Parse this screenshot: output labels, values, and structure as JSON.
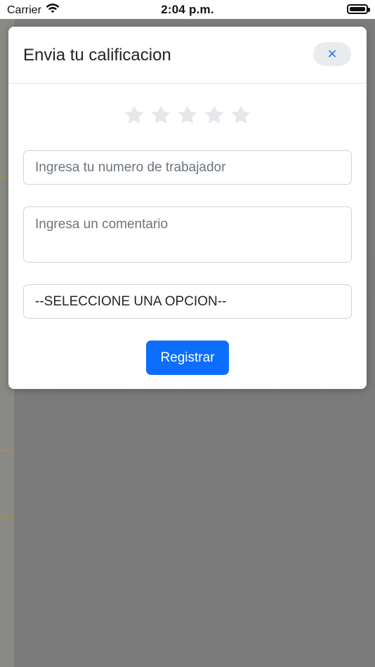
{
  "status_bar": {
    "carrier": "Carrier",
    "time": "2:04 p.m."
  },
  "modal": {
    "title": "Envia tu calificacion",
    "close_icon": "×",
    "rating": {
      "max": 5,
      "selected": 0
    },
    "worker_input": {
      "placeholder": "Ingresa tu numero de trabajador",
      "value": ""
    },
    "comment_input": {
      "placeholder": "Ingresa un comentario",
      "value": ""
    },
    "select": {
      "selected": "--SELECCIONE UNA OPCION--"
    },
    "submit_label": "Registrar"
  },
  "colors": {
    "accent": "#0d6efd",
    "star_inactive": "#e5e7ea"
  },
  "icons": {
    "wifi": "wifi-icon",
    "battery": "battery-icon",
    "close": "close-icon",
    "star": "star-icon"
  }
}
